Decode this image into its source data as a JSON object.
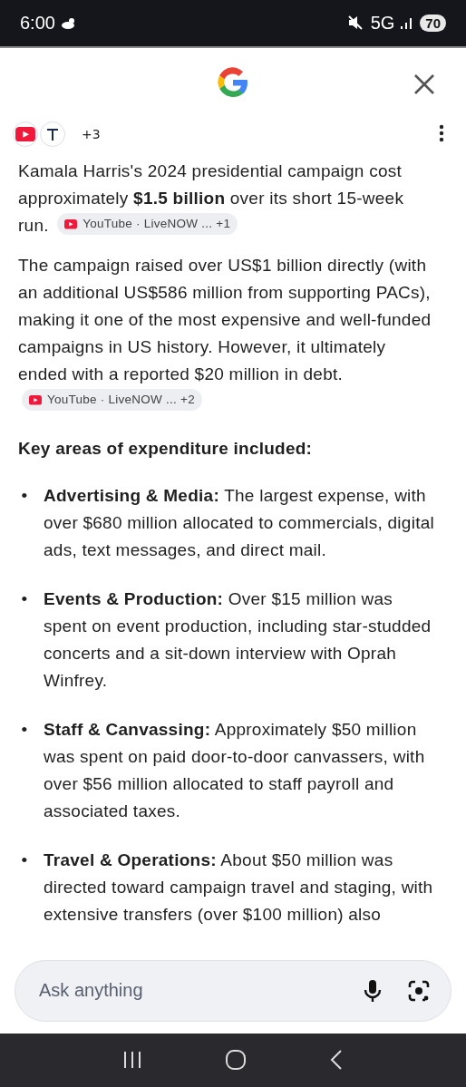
{
  "status_bar": {
    "time": "6:00",
    "network": "5G",
    "battery": "70"
  },
  "sources": {
    "more": "+3"
  },
  "paragraphs": [
    {
      "text": "Kamala Harris's 2024 presidential campaign cost approximately **$1.5 billion** over its short 15-week run.",
      "chip": {
        "label": "YouTube · LiveNOW ...",
        "count": "+1"
      }
    },
    {
      "text": "The campaign raised over US$1 billion directly (with an additional US$586 million from supporting PACs), making it one of the most expensive and well-funded campaigns in US history. However, it ultimately ended with a reported $20 million in debt.",
      "chip": {
        "label": "YouTube · LiveNOW ...",
        "count": "+2"
      }
    }
  ],
  "heading": "Key areas of expenditure included:",
  "bullets": [
    {
      "marker": "•",
      "text": "**Advertising & Media:** The largest expense, with over $680 million allocated to commercials, digital ads, text messages, and direct mail."
    },
    {
      "marker": "•",
      "text": "**Events & Production:** Over $15 million was spent on event production, including star-studded concerts and a sit-down interview with Oprah Winfrey."
    },
    {
      "marker": "•",
      "text": "**Staff & Canvassing:** Approximately $50 million was spent on paid door-to-door canvassers, with over $56 million allocated to staff payroll and associated taxes."
    },
    {
      "marker": "•",
      "text": "**Travel & Operations:** About $50 million was directed toward campaign travel and staging, with extensive transfers (over $100 million) also"
    }
  ],
  "input": {
    "placeholder": "Ask anything"
  }
}
